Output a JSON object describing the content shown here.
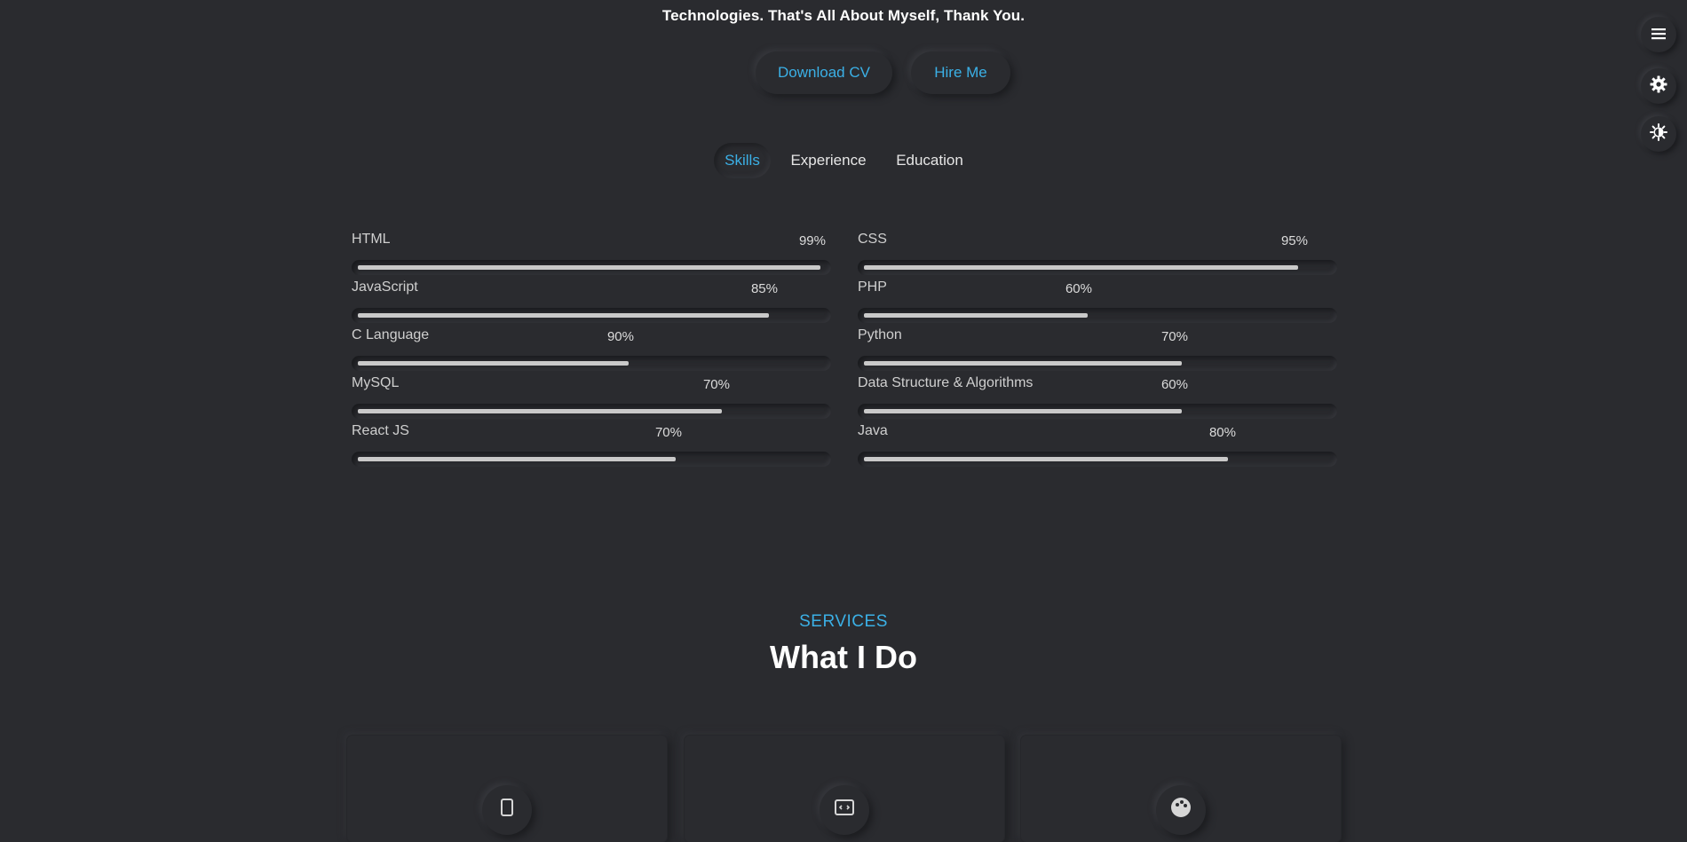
{
  "intro": {
    "line1": "",
    "line2": "Technologies. That's All About Myself, Thank You."
  },
  "buttons": {
    "download_cv": "Download CV",
    "hire_me": "Hire Me"
  },
  "tabs": [
    {
      "label": "Skills",
      "active": true
    },
    {
      "label": "Experience",
      "active": false
    },
    {
      "label": "Education",
      "active": false
    }
  ],
  "skills": [
    {
      "name": "HTML",
      "percent_label": "99%",
      "bar_level": 0.99
    },
    {
      "name": "CSS",
      "percent_label": "95%",
      "bar_level": 0.93
    },
    {
      "name": "JavaScript",
      "percent_label": "85%",
      "bar_level": 0.88
    },
    {
      "name": "PHP",
      "percent_label": "60%",
      "bar_level": 0.48
    },
    {
      "name": "C Language",
      "percent_label": "90%",
      "bar_level": 0.58
    },
    {
      "name": "Python",
      "percent_label": "70%",
      "bar_level": 0.68
    },
    {
      "name": "MySQL",
      "percent_label": "70%",
      "bar_level": 0.78
    },
    {
      "name": "Data Structure & Algorithms",
      "percent_label": "60%",
      "bar_level": 0.68
    },
    {
      "name": "React JS",
      "percent_label": "70%",
      "bar_level": 0.68
    },
    {
      "name": "Java",
      "percent_label": "80%",
      "bar_level": 0.78
    }
  ],
  "services": {
    "label": "SERVICES",
    "title": "What I Do",
    "cards": [
      {
        "icon": "mobile-icon"
      },
      {
        "icon": "code-window-icon"
      },
      {
        "icon": "palette-icon"
      }
    ]
  },
  "side_controls": [
    {
      "icon": "menu-icon"
    },
    {
      "icon": "gear-icon"
    },
    {
      "icon": "theme-toggle-icon"
    }
  ],
  "colors": {
    "background": "#2a2b2f",
    "accent": "#3bb0e6",
    "text": "#ffffff",
    "bar_fill": "#c9c9c9"
  }
}
